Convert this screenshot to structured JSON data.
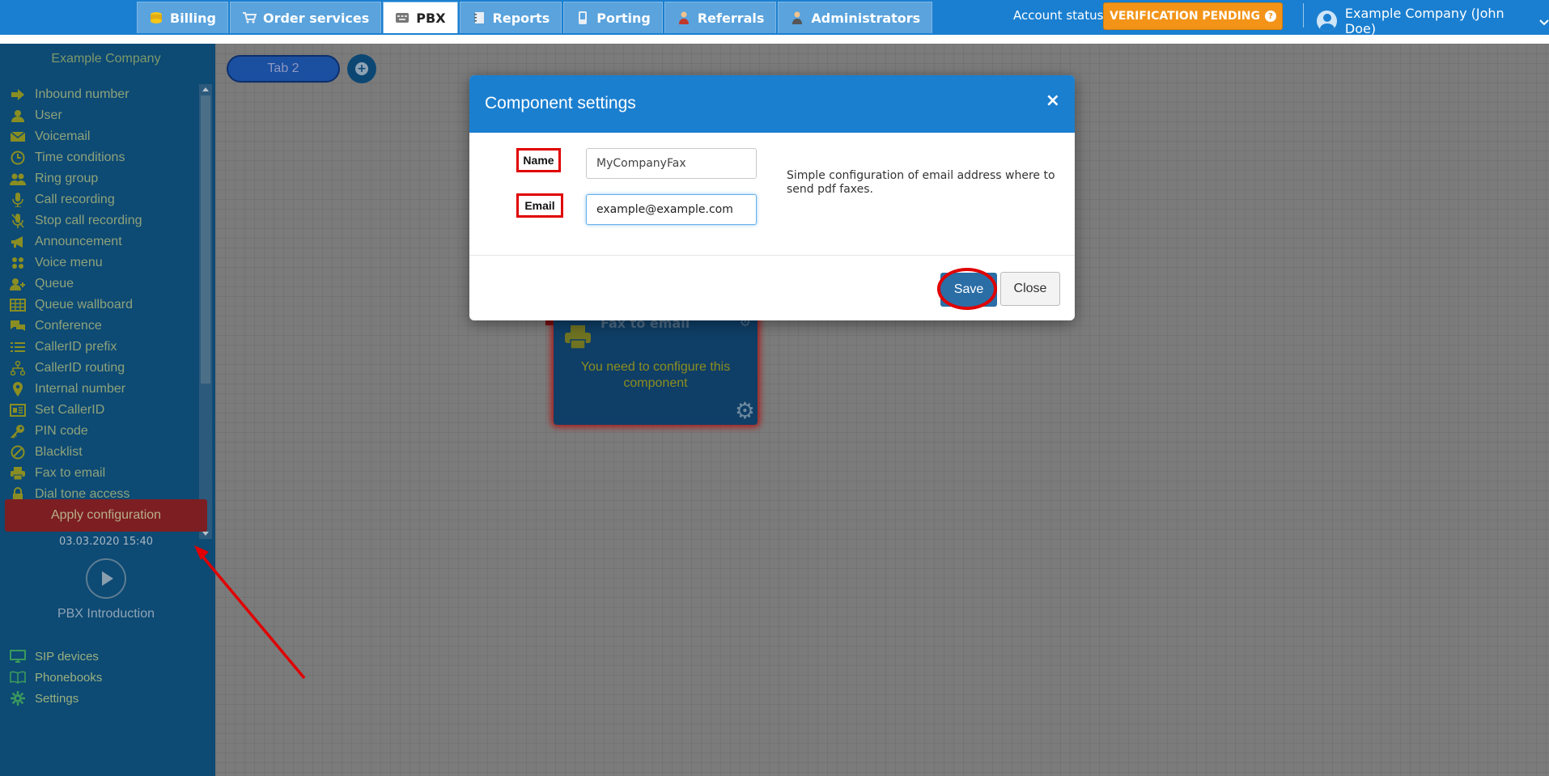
{
  "topbar": {
    "tabs": [
      {
        "label": "Billing",
        "icon": "coins-icon"
      },
      {
        "label": "Order services",
        "icon": "cart-icon"
      },
      {
        "label": "PBX",
        "icon": "pbx-icon",
        "active": true
      },
      {
        "label": "Reports",
        "icon": "notebook-icon"
      },
      {
        "label": "Porting",
        "icon": "phone-icon"
      },
      {
        "label": "Referrals",
        "icon": "person-icon"
      },
      {
        "label": "Administrators",
        "icon": "admin-icon"
      }
    ],
    "account_status_label": "Account status:",
    "account_status_value": "VERIFICATION PENDING",
    "user_label": "Example Company (John Doe)"
  },
  "sidebar": {
    "company": "Example Company",
    "components": [
      {
        "label": "Inbound number",
        "icon": "arrow-right-icon"
      },
      {
        "label": "User",
        "icon": "user-icon"
      },
      {
        "label": "Voicemail",
        "icon": "envelope-icon"
      },
      {
        "label": "Time conditions",
        "icon": "clock-icon"
      },
      {
        "label": "Ring group",
        "icon": "group-icon"
      },
      {
        "label": "Call recording",
        "icon": "microphone-icon"
      },
      {
        "label": "Stop call recording",
        "icon": "microphone-off-icon"
      },
      {
        "label": "Announcement",
        "icon": "megaphone-icon"
      },
      {
        "label": "Voice menu",
        "icon": "grid-icon"
      },
      {
        "label": "Queue",
        "icon": "user-plus-icon"
      },
      {
        "label": "Queue wallboard",
        "icon": "table-icon"
      },
      {
        "label": "Conference",
        "icon": "chat-icon"
      },
      {
        "label": "CallerID prefix",
        "icon": "list-icon"
      },
      {
        "label": "CallerID routing",
        "icon": "sitemap-icon"
      },
      {
        "label": "Internal number",
        "icon": "pin-icon"
      },
      {
        "label": "Set CallerID",
        "icon": "id-card-icon"
      },
      {
        "label": "PIN code",
        "icon": "key-icon"
      },
      {
        "label": "Blacklist",
        "icon": "ban-icon"
      },
      {
        "label": "Fax to email",
        "icon": "fax-icon"
      },
      {
        "label": "Dial tone access",
        "icon": "lock-icon"
      }
    ],
    "apply_label": "Apply configuration",
    "apply_date": "03.03.2020 15:40",
    "intro_label": "PBX Introduction",
    "extras": [
      {
        "label": "SIP devices",
        "icon": "monitor-icon"
      },
      {
        "label": "Phonebooks",
        "icon": "book-icon"
      },
      {
        "label": "Settings",
        "icon": "gear-icon"
      }
    ],
    "language_icon": "uk-flag-icon"
  },
  "canvas": {
    "tab_label": "Tab 2",
    "add_tab_icon": "plus-circle-icon",
    "node": {
      "title": "Fax to email",
      "message": "You need to configure this component"
    }
  },
  "modal": {
    "title": "Component settings",
    "close_symbol": "×",
    "name_label": "Name",
    "name_value": "MyCompanyFax",
    "email_label": "Email",
    "email_value": "example@example.com",
    "description": "Simple configuration of email address where to send pdf faxes.",
    "save_label": "Save",
    "close_label": "Close"
  },
  "colors": {
    "topbar": "#1a7fd0",
    "sidebar": "#0d4a74",
    "verification": "#f39418",
    "annotation_red": "#e00000"
  }
}
